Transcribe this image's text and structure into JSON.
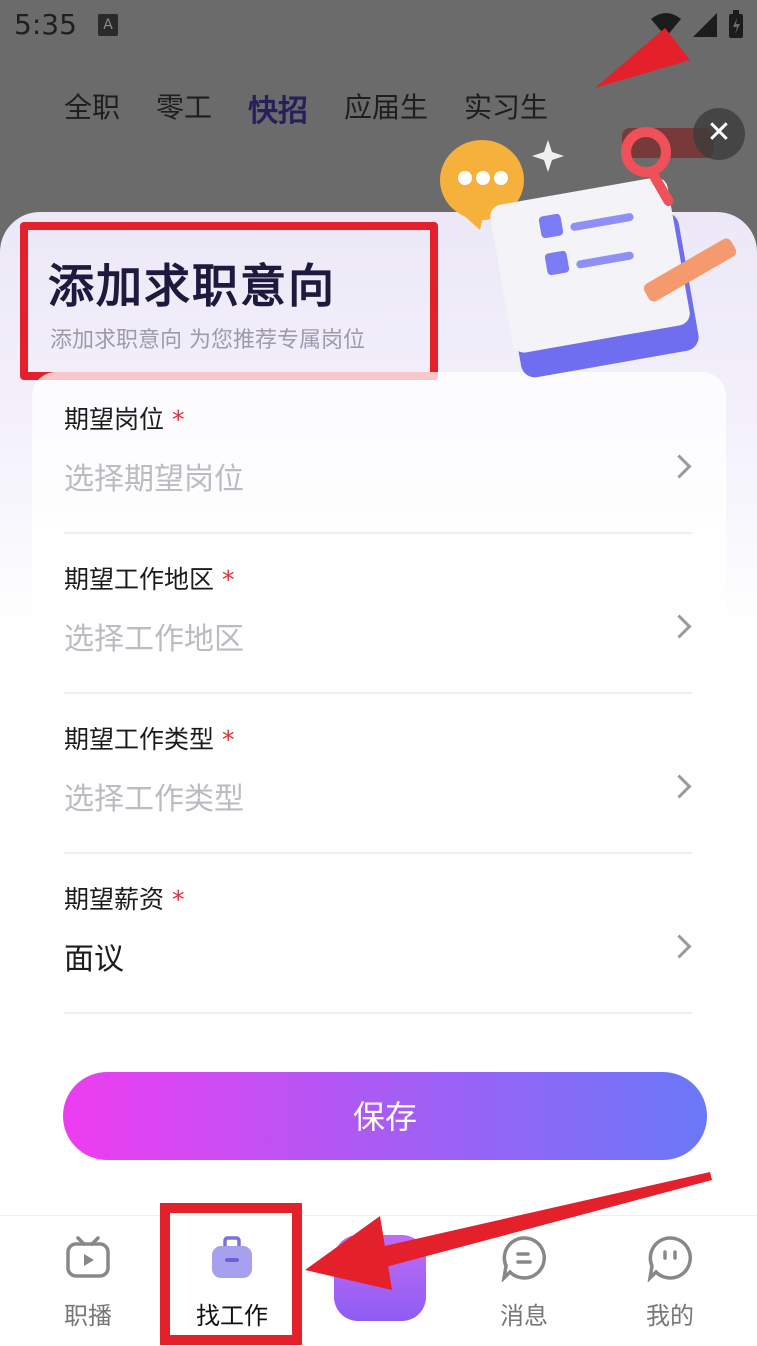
{
  "status_bar": {
    "time": "5:35",
    "a_badge": "A"
  },
  "background_tabs": [
    "全职",
    "零工",
    "快招",
    "应届生",
    "实习生"
  ],
  "background_active_tab": "快招",
  "close_symbol": "✕",
  "modal": {
    "title": "添加求职意向",
    "subtitle": "添加求职意向 为您推荐专属岗位",
    "fields": [
      {
        "label": "期望岗位",
        "required_mark": "*",
        "value": "选择期望岗位",
        "filled": false
      },
      {
        "label": "期望工作地区",
        "required_mark": "*",
        "value": "选择工作地区",
        "filled": false
      },
      {
        "label": "期望工作类型",
        "required_mark": "*",
        "value": "选择工作类型",
        "filled": false
      },
      {
        "label": "期望薪资",
        "required_mark": "*",
        "value": "面议",
        "filled": true
      }
    ],
    "save_label": "保存"
  },
  "bottom_nav": [
    {
      "label": "职播",
      "icon": "tv-icon",
      "active": false
    },
    {
      "label": "找工作",
      "icon": "briefcase-icon",
      "active": true
    },
    {
      "label": "消息",
      "icon": "message-icon",
      "active": false
    },
    {
      "label": "我的",
      "icon": "profile-icon",
      "active": false
    }
  ],
  "colors": {
    "accent_gradient_start": "#ee3cf0",
    "accent_gradient_end": "#6a78f8",
    "annotation_red": "#e4202b",
    "required_red": "#e0303a"
  }
}
